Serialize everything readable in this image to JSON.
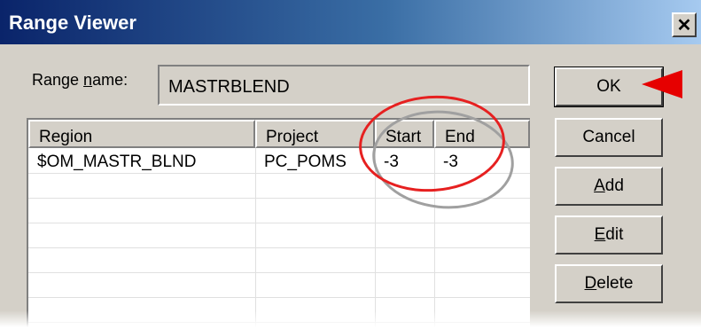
{
  "window": {
    "title": "Range Viewer",
    "close_symbol": "✕"
  },
  "range_name": {
    "label_prefix": "Range ",
    "label_mnemonic": "n",
    "label_suffix": "ame:",
    "value": "MASTRBLEND"
  },
  "table": {
    "columns": [
      "Region",
      "Project",
      "Start",
      "End"
    ],
    "rows": [
      [
        "$OM_MASTR_BLND",
        "PC_POMS",
        "-3",
        "-3"
      ]
    ]
  },
  "buttons": {
    "ok": "OK",
    "cancel": "Cancel",
    "add_mnemonic": "A",
    "add_rest": "dd",
    "edit_mnemonic": "E",
    "edit_rest": "dit",
    "delete_mnemonic": "D",
    "delete_rest": "elete"
  },
  "annotations": {
    "highlight_color": "#e62020",
    "arrow_color": "#e60000"
  }
}
